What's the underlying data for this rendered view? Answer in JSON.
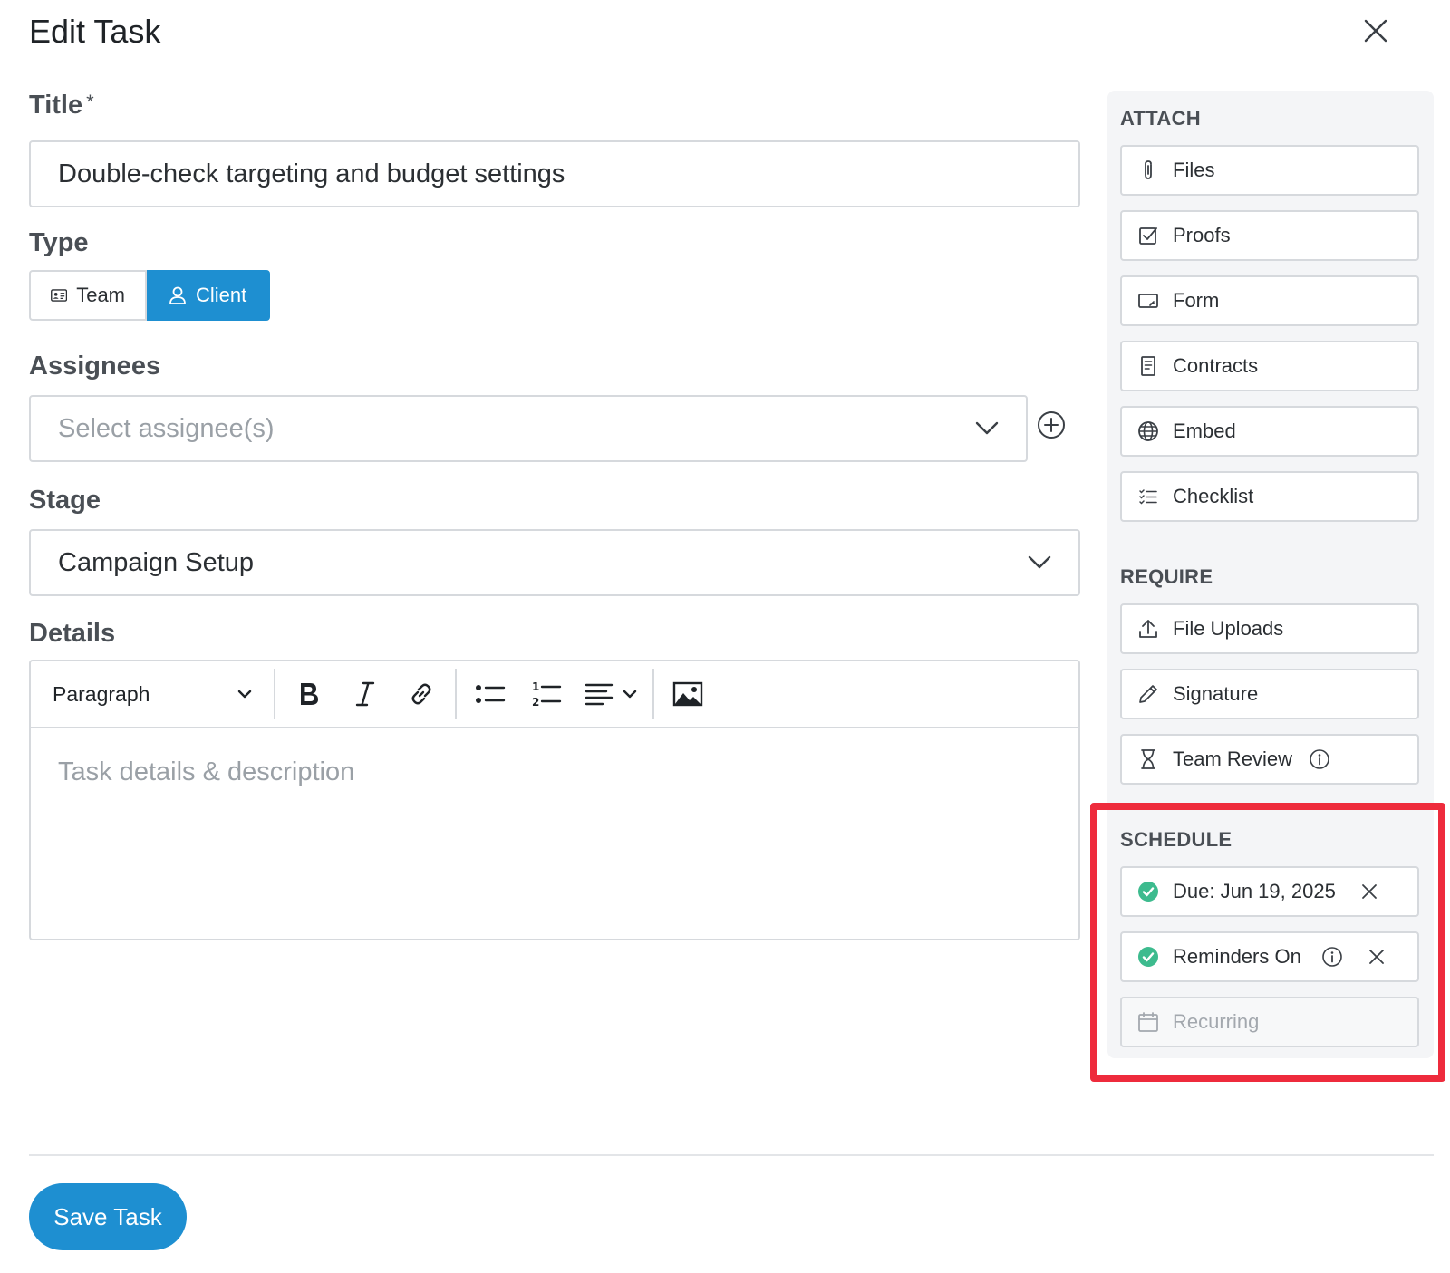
{
  "modal": {
    "title": "Edit Task"
  },
  "title_field": {
    "label": "Title",
    "required_mark": "*",
    "value": "Double-check targeting and budget settings"
  },
  "type_field": {
    "label": "Type",
    "options": [
      {
        "label": "Team",
        "icon": "id-card-icon",
        "selected": false
      },
      {
        "label": "Client",
        "icon": "person-icon",
        "selected": true
      }
    ]
  },
  "assignees": {
    "label": "Assignees",
    "placeholder": "Select assignee(s)"
  },
  "stage": {
    "label": "Stage",
    "value": "Campaign Setup"
  },
  "details": {
    "label": "Details",
    "block_format": "Paragraph",
    "placeholder": "Task details & description"
  },
  "side": {
    "attach_heading": "ATTACH",
    "attach": [
      {
        "label": "Files",
        "icon": "paperclip-icon"
      },
      {
        "label": "Proofs",
        "icon": "checkbox-icon"
      },
      {
        "label": "Form",
        "icon": "form-icon"
      },
      {
        "label": "Contracts",
        "icon": "document-icon"
      },
      {
        "label": "Embed",
        "icon": "globe-icon"
      },
      {
        "label": "Checklist",
        "icon": "checklist-icon"
      }
    ],
    "require_heading": "REQUIRE",
    "require": [
      {
        "label": "File Uploads",
        "icon": "upload-icon"
      },
      {
        "label": "Signature",
        "icon": "pen-icon"
      },
      {
        "label": "Team Review",
        "icon": "hourglass-icon"
      }
    ],
    "schedule_heading": "SCHEDULE",
    "schedule": [
      {
        "label": "Due: Jun 19, 2025",
        "icon": "check-circle-icon",
        "active": true
      },
      {
        "label": "Reminders On",
        "icon": "check-circle-icon",
        "active": true
      },
      {
        "label": "Recurring",
        "icon": "calendar-icon",
        "active": false
      }
    ]
  },
  "footer": {
    "save_label": "Save Task"
  },
  "colors": {
    "accent": "#1e8fd1",
    "success": "#3dbb8e",
    "highlight": "#ee2b3c"
  }
}
